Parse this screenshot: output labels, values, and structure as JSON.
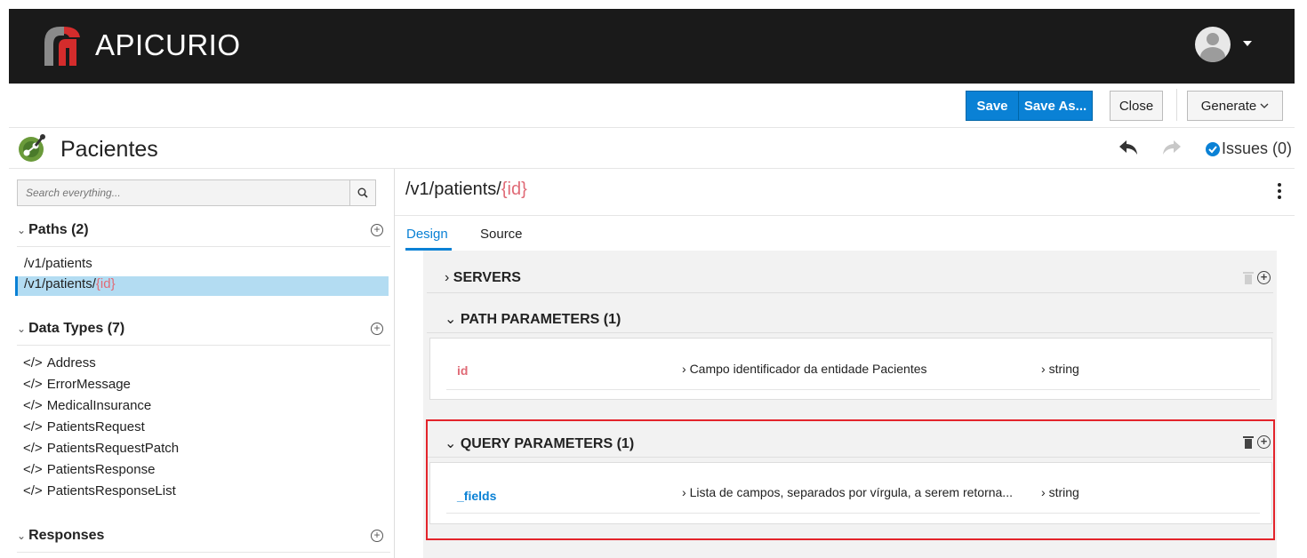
{
  "header": {
    "brand": "APICURIO"
  },
  "toolbar": {
    "save": "Save",
    "save_as": "Save As...",
    "close": "Close",
    "generate": "Generate"
  },
  "api": {
    "title": "Pacientes",
    "issues": "Issues (0)"
  },
  "sidebar": {
    "search_placeholder": "Search everything...",
    "paths_header": "Paths (2)",
    "paths": [
      {
        "prefix": "/v1/patients",
        "param": ""
      },
      {
        "prefix": "/v1/patients/",
        "param": "{id}"
      }
    ],
    "data_types_header": "Data Types (7)",
    "data_types": [
      "Address",
      "ErrorMessage",
      "MedicalInsurance",
      "PatientsRequest",
      "PatientsRequestPatch",
      "PatientsResponse",
      "PatientsResponseList"
    ],
    "type_prefix": "</>",
    "responses_header": "Responses"
  },
  "main": {
    "path_prefix": "/v1/patients/",
    "path_param": "{id}",
    "tabs": [
      "Design",
      "Source"
    ],
    "servers_label": "SERVERS",
    "path_params_label": "PATH PARAMETERS (1)",
    "path_params": [
      {
        "name": "id",
        "description": "Campo identificador da entidade Pacientes",
        "type": "string"
      }
    ],
    "query_params_label": "QUERY PARAMETERS (1)",
    "query_params": [
      {
        "name": "_fields",
        "description": "Lista de campos, separados por vírgula, a serem retorna...",
        "type": "string"
      }
    ]
  },
  "colors": {
    "primary": "#0a81d5",
    "header_bg": "#1a1a1a",
    "param_red": "#e06a76",
    "highlight": "#e3242b"
  }
}
